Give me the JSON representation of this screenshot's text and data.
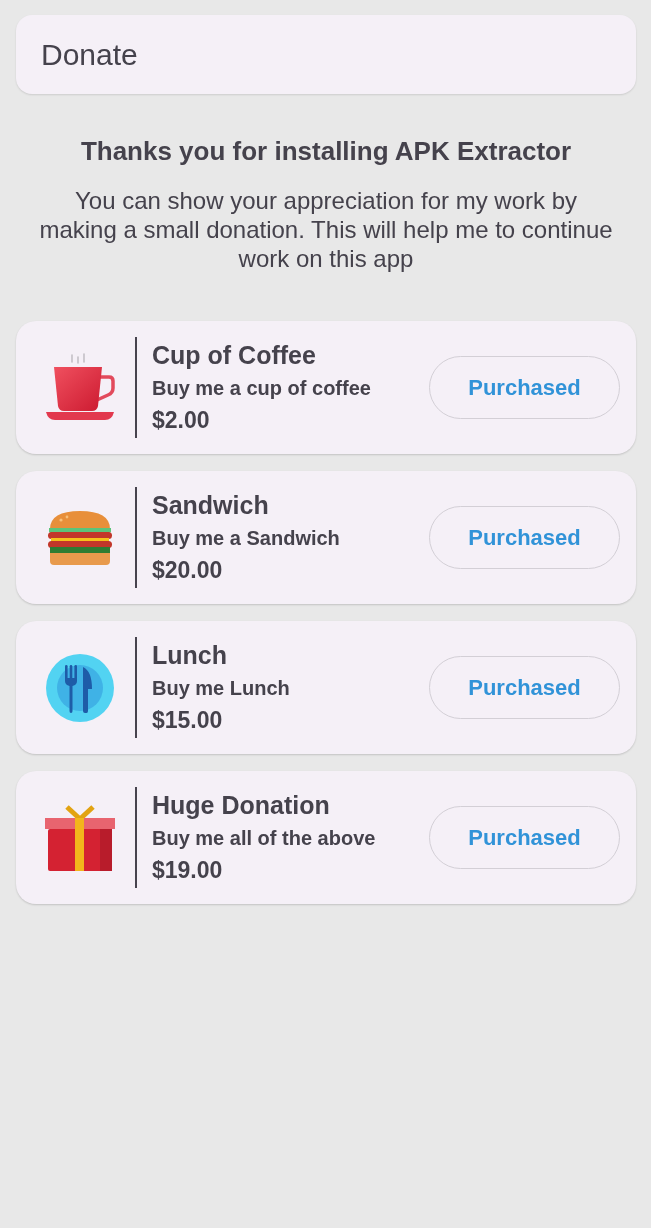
{
  "header": {
    "title": "Donate"
  },
  "intro": {
    "heading": "Thanks you for installing APK Extractor",
    "text": "You can show your appreciation for my work by making a small donation. This will help me to continue work on this app"
  },
  "items": [
    {
      "kind": "coffee",
      "title": "Cup of Coffee",
      "description": "Buy me a cup of coffee",
      "price": "$2.00",
      "button": "Purchased"
    },
    {
      "kind": "burger",
      "title": "Sandwich",
      "description": "Buy me a Sandwich",
      "price": "$20.00",
      "button": "Purchased"
    },
    {
      "kind": "lunch",
      "title": "Lunch",
      "description": "Buy me Lunch",
      "price": "$15.00",
      "button": "Purchased"
    },
    {
      "kind": "gift",
      "title": "Huge Donation",
      "description": "Buy me all of the above",
      "price": "$19.00",
      "button": "Purchased"
    }
  ]
}
